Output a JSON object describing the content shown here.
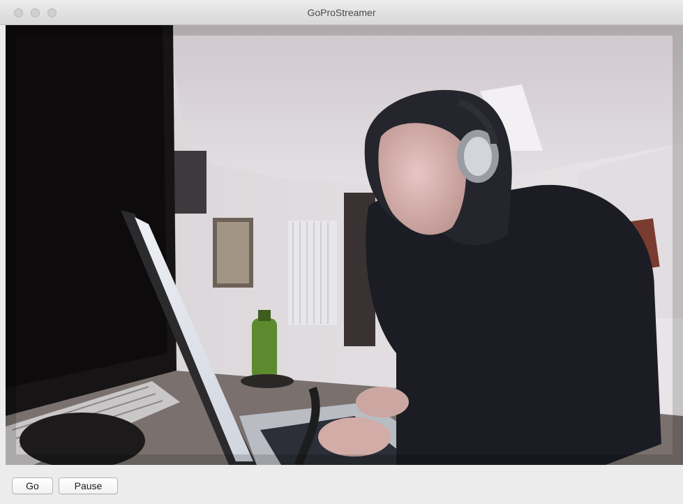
{
  "window": {
    "title": "GoProStreamer"
  },
  "controls": {
    "go_label": "Go",
    "pause_label": "Pause"
  }
}
